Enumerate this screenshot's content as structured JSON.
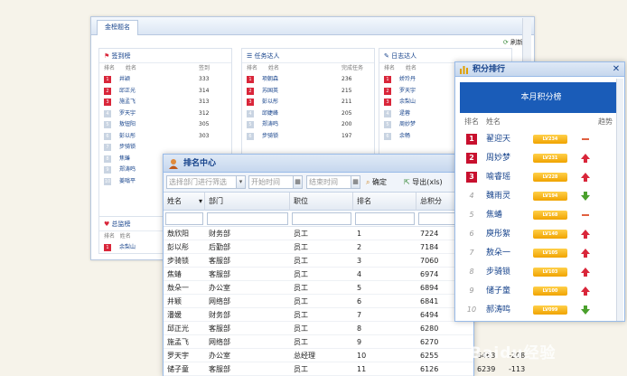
{
  "main": {
    "tab": "金榜题名",
    "refresh_label": "刷新",
    "panels": [
      {
        "title": "签到榜",
        "cols": [
          "排名",
          "姓名",
          "签到"
        ],
        "rows": [
          [
            "1",
            "井颖",
            "333"
          ],
          [
            "2",
            "邱正光",
            "314"
          ],
          [
            "3",
            "施孟飞",
            "313"
          ],
          [
            "4",
            "罗天宇",
            "312"
          ],
          [
            "5",
            "敖钮阳",
            "305"
          ],
          [
            "6",
            "彭以彤",
            "303"
          ],
          [
            "7",
            "步骑锁",
            ""
          ],
          [
            "8",
            "焦蝽",
            ""
          ],
          [
            "9",
            "郑涛鸣",
            ""
          ],
          [
            "10",
            "姜嗡平",
            ""
          ]
        ]
      },
      {
        "title": "任务达人",
        "cols": [
          "排名",
          "姓名",
          "完成任务"
        ],
        "rows": [
          [
            "1",
            "项朝森",
            "236"
          ],
          [
            "2",
            "苏国英",
            "215"
          ],
          [
            "3",
            "彭以彤",
            "211"
          ],
          [
            "4",
            "邱婕峰",
            "205"
          ],
          [
            "5",
            "郑涛鸣",
            "200"
          ],
          [
            "6",
            "步骑锁",
            "197"
          ]
        ]
      },
      {
        "title": "日志达人",
        "cols": [
          "排名",
          "姓名",
          ""
        ],
        "rows": [
          [
            "1",
            "娇玲丹",
            ""
          ],
          [
            "2",
            "罗天宇",
            ""
          ],
          [
            "3",
            "余梨山",
            ""
          ],
          [
            "4",
            "逯蓉",
            ""
          ],
          [
            "5",
            "周妙梦",
            ""
          ],
          [
            "6",
            "余畅",
            ""
          ]
        ]
      }
    ],
    "bottom_panel": {
      "title": "总监榜",
      "cols": [
        "排名",
        "姓名"
      ],
      "rows": [
        [
          "1",
          "余梨山"
        ]
      ]
    }
  },
  "rank_center": {
    "title": "排名中心",
    "dept_placeholder": "选择部门进行筛选",
    "start_placeholder": "开始时间",
    "end_placeholder": "结束时间",
    "confirm_label": "确定",
    "export_label": "导出(xls)",
    "columns": [
      "姓名",
      "部门",
      "职位",
      "排名",
      "总积分"
    ],
    "rows": [
      [
        "敖欣阳",
        "财务部",
        "员工",
        "1",
        "7224",
        "",
        ""
      ],
      [
        "彭以彤",
        "后勤部",
        "员工",
        "2",
        "7184",
        "",
        ""
      ],
      [
        "步骑锁",
        "客服部",
        "员工",
        "3",
        "7060",
        "",
        ""
      ],
      [
        "焦蝽",
        "客服部",
        "员工",
        "4",
        "6974",
        "",
        ""
      ],
      [
        "敖朵一",
        "办公室",
        "员工",
        "5",
        "6894",
        "",
        ""
      ],
      [
        "井颖",
        "网络部",
        "员工",
        "6",
        "6841",
        "",
        ""
      ],
      [
        "潘媛",
        "财务部",
        "员工",
        "7",
        "6494",
        "",
        ""
      ],
      [
        "邱正光",
        "客服部",
        "员工",
        "8",
        "6280",
        "",
        ""
      ],
      [
        "施孟飞",
        "网络部",
        "员工",
        "9",
        "6270",
        "",
        ""
      ],
      [
        "罗天宇",
        "办公室",
        "总经理",
        "10",
        "6255",
        "6463",
        "-208"
      ],
      [
        "储子童",
        "客服部",
        "员工",
        "11",
        "6126",
        "6239",
        "-113"
      ]
    ]
  },
  "points_ranking": {
    "title": "积分排行",
    "banner": "本月积分榜",
    "cols": [
      "排名",
      "姓名",
      "趋势"
    ],
    "rows": [
      {
        "rank": "1",
        "name": "翟迎天",
        "level": "LV234",
        "trend": "flat"
      },
      {
        "rank": "2",
        "name": "周妙梦",
        "level": "LV231",
        "trend": "up"
      },
      {
        "rank": "3",
        "name": "喻睿瑶",
        "level": "LV228",
        "trend": "up"
      },
      {
        "rank": "4",
        "name": "魏雨灵",
        "level": "LV194",
        "trend": "down"
      },
      {
        "rank": "5",
        "name": "焦蝽",
        "level": "LV168",
        "trend": "flat"
      },
      {
        "rank": "6",
        "name": "庾彤絮",
        "level": "LV140",
        "trend": "up"
      },
      {
        "rank": "7",
        "name": "敖朵一",
        "level": "LV105",
        "trend": "up"
      },
      {
        "rank": "8",
        "name": "步骑锁",
        "level": "LV103",
        "trend": "up"
      },
      {
        "rank": "9",
        "name": "储子童",
        "level": "LV100",
        "trend": "up"
      },
      {
        "rank": "10",
        "name": "郝涛鸣",
        "level": "LV099",
        "trend": "down"
      }
    ]
  },
  "watermark": "Baidu经验",
  "colors": {
    "accent": "#15428b",
    "banner": "#1a5cb8",
    "top_rank": "#c8102e",
    "up": "#d9263a",
    "down": "#4aa02c",
    "level": "#f0a300"
  }
}
